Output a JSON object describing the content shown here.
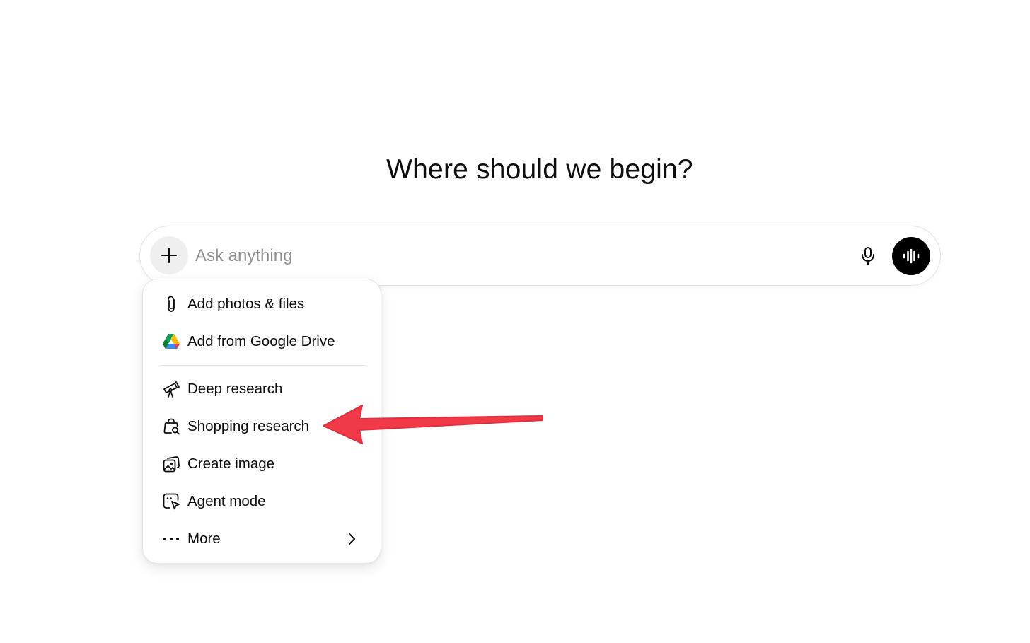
{
  "heading": "Where should we begin?",
  "composer": {
    "placeholder": "Ask anything",
    "value": "",
    "plus_icon": "plus-icon",
    "mic_icon": "microphone-icon",
    "voice_icon": "voice-waveform-icon"
  },
  "menu": {
    "items": [
      {
        "label": "Add photos & files",
        "icon": "paperclip-icon"
      },
      {
        "label": "Add from Google Drive",
        "icon": "google-drive-icon"
      },
      {
        "label": "Deep research",
        "icon": "telescope-icon"
      },
      {
        "label": "Shopping research",
        "icon": "shopping-bag-search-icon"
      },
      {
        "label": "Create image",
        "icon": "image-icon"
      },
      {
        "label": "Agent mode",
        "icon": "agent-cursor-icon"
      },
      {
        "label": "More",
        "icon": "ellipsis-icon",
        "submenu_icon": "chevron-right-icon"
      }
    ]
  },
  "colors": {
    "annotation_arrow": "#f03a47",
    "voice_button": "#000000",
    "plus_button_bg": "#efefef"
  }
}
